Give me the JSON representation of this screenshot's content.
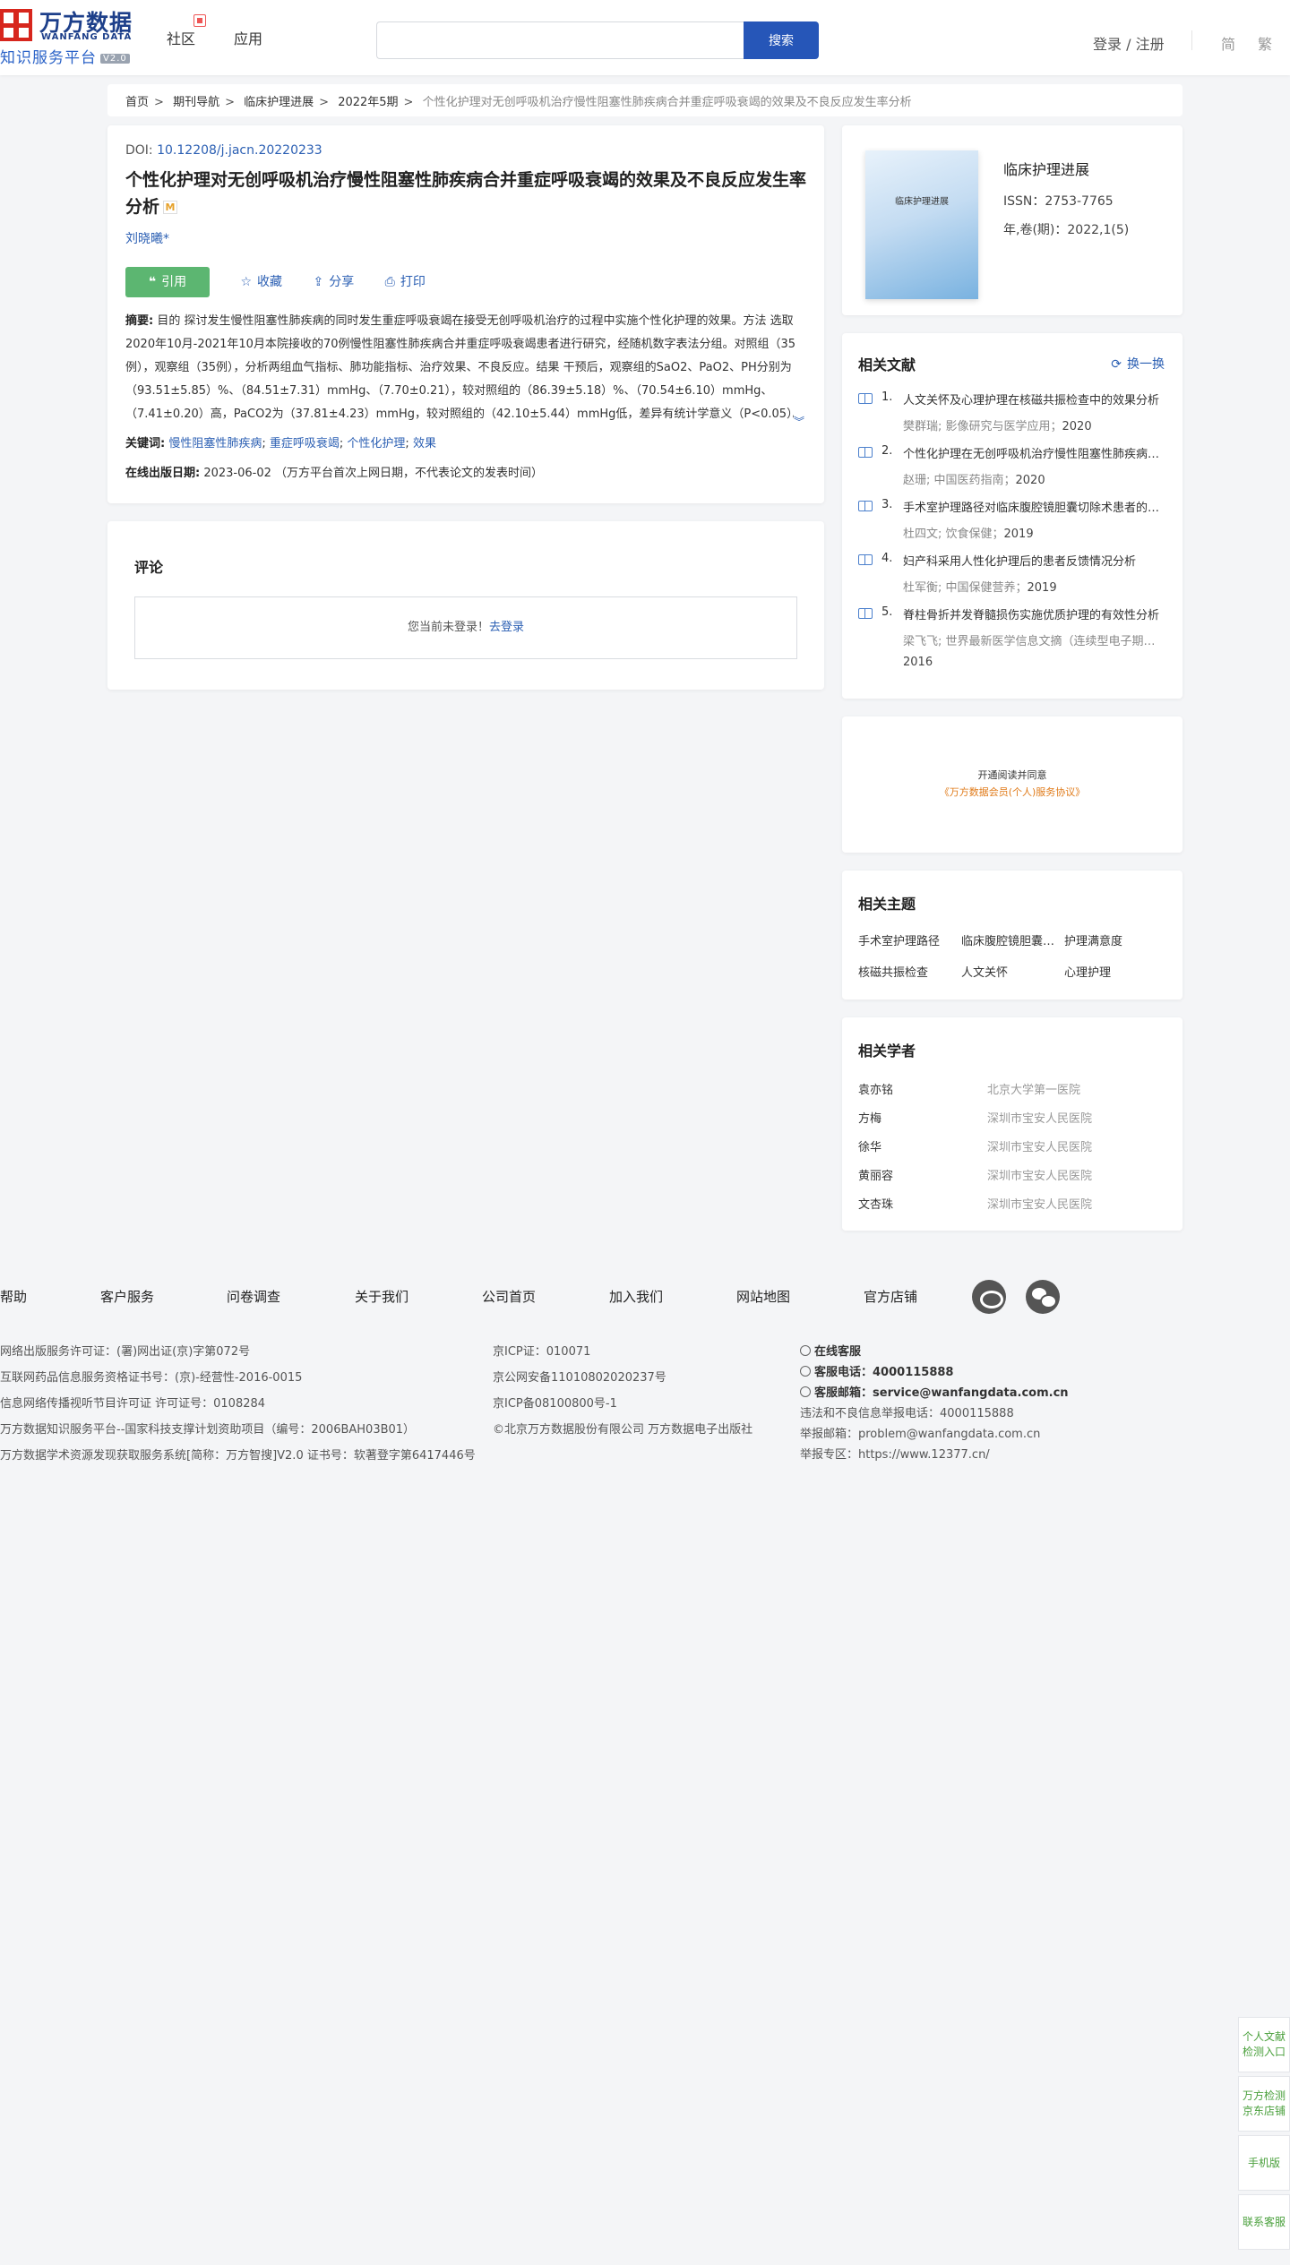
{
  "header": {
    "logo_cn": "万方数据",
    "logo_en": "WANFANG DATA",
    "platform_name": "知识服务平台",
    "version": "V2.0",
    "nav": [
      "社区",
      "应用"
    ],
    "search_placeholder": "",
    "search_button": "搜索",
    "login": "登录 / 注册",
    "lang_simplified": "简",
    "lang_traditional": "繁"
  },
  "breadcrumb": {
    "items": [
      "首页",
      "期刊导航",
      "临床护理进展",
      "2022年5期"
    ],
    "current": "个性化护理对无创呼吸机治疗慢性阻塞性肺疾病合并重症呼吸衰竭的效果及不良反应发生率分析"
  },
  "article": {
    "doi_label": "DOI:",
    "doi": "10.12208/j.jacn.20220233",
    "title": "个性化护理对无创呼吸机治疗慢性阻塞性肺疾病合并重症呼吸衰竭的效果及不良反应发生率分析",
    "title_badge": "M",
    "author": "刘晓曦*",
    "actions": {
      "cite": "引用",
      "collect": "收藏",
      "share": "分享",
      "print": "打印"
    },
    "abstract_label": "摘要:",
    "abstract": "目的 探讨发生慢性阻塞性肺疾病的同时发生重症呼吸衰竭在接受无创呼吸机治疗的过程中实施个性化护理的效果。方法 选取2020年10月-2021年10月本院接收的70例慢性阻塞性肺疾病合并重症呼吸衰竭患者进行研究，经随机数字表法分组。对照组（35例），观察组（35例），分析两组血气指标、肺功能指标、治疗效果、不良反应。结果 干预后，观察组的SaO2、PaO2、PH分别为（93.51±5.85）%、（84.51±7.31）mmHg、（7.70±0.21），较对照组的（86.39±5.18）%、（70.54±6.10）mmHg、（7.41±0.20）高，PaCO2为（37.81±4.23）mmHg，较对照组的（42.10±5.44）mmHg低，差异有统计学意义（P<0.05）。",
    "keywords_label": "关键词:",
    "keywords": [
      "慢性阻塞性肺疾病",
      "重症呼吸衰竭",
      "个性化护理",
      "效果"
    ],
    "pubdate_label": "在线出版日期:",
    "pubdate": "2023-06-02 （万方平台首次上网日期，不代表论文的发表时间）"
  },
  "comments": {
    "title": "评论",
    "not_logged_in": "您当前未登录！",
    "login_link": "去登录"
  },
  "journal": {
    "cover_title": "临床护理进展",
    "name": "临床护理进展",
    "issn": "ISSN：2753-7765",
    "volume": "年,卷(期)：2022,1(5)"
  },
  "related_docs": {
    "title": "相关文献",
    "refresh": "换一换",
    "items": [
      {
        "num": "1.",
        "title": "人文关怀及心理护理在核磁共振检查中的效果分析",
        "meta": "樊群瑞; 影像研究与医学应用；",
        "year": "2020"
      },
      {
        "num": "2.",
        "title": "个性化护理在无创呼吸机治疗慢性阻塞性肺疾病中的应用",
        "meta": "赵珊; 中国医药指南；",
        "year": "2020"
      },
      {
        "num": "3.",
        "title": "手术室护理路径对临床腹腔镜胆囊切除术患者的影响",
        "meta": "杜四文; 饮食保健；",
        "year": "2019"
      },
      {
        "num": "4.",
        "title": "妇产科采用人性化护理后的患者反馈情况分析",
        "meta": "杜军衡; 中国保健营养；",
        "year": "2019"
      },
      {
        "num": "5.",
        "title": "脊柱骨折并发脊髓损伤实施优质护理的有效性分析",
        "meta": "梁飞飞; 世界最新医学信息文摘（连续型电子期刊）；",
        "year": "2016"
      }
    ]
  },
  "agreement": {
    "line1": "开通阅读并同意",
    "link": "《万方数据会员(个人)服务协议》"
  },
  "topics": {
    "title": "相关主题",
    "items": [
      "手术室护理路径",
      "临床腹腔镜胆囊切除术",
      "护理满意度",
      "核磁共振检查",
      "人文关怀",
      "心理护理"
    ]
  },
  "scholars": {
    "title": "相关学者",
    "items": [
      {
        "name": "袁亦铭",
        "inst": "北京大学第一医院"
      },
      {
        "name": "方梅",
        "inst": "深圳市宝安人民医院"
      },
      {
        "name": "徐华",
        "inst": "深圳市宝安人民医院"
      },
      {
        "name": "黄丽容",
        "inst": "深圳市宝安人民医院"
      },
      {
        "name": "文杏珠",
        "inst": "深圳市宝安人民医院"
      }
    ]
  },
  "footer": {
    "links": [
      "帮助",
      "客户服务",
      "问卷调查",
      "关于我们",
      "公司首页",
      "加入我们",
      "网站地图",
      "官方店铺"
    ],
    "col1": [
      "网络出版服务许可证：(署)网出证(京)字第072号",
      "互联网药品信息服务资格证书号：(京)-经营性-2016-0015",
      "信息网络传播视听节目许可证 许可证号：0108284",
      "万方数据知识服务平台--国家科技支撑计划资助项目（编号：2006BAH03B01）",
      "万方数据学术资源发现获取服务系统[简称：万方智搜]V2.0 证书号：软著登字第6417446号"
    ],
    "col2": [
      "京ICP证：010071",
      "京公网安备11010802020237号",
      "京ICP备08100800号-1",
      "©北京万方数据股份有限公司 万方数据电子出版社"
    ],
    "online_service": "在线客服",
    "phone_label": "客服电话：",
    "phone": "4000115888",
    "email_label": "客服邮箱：",
    "email": "service@wanfangdata.com.cn",
    "report_phone": "违法和不良信息举报电话：4000115888",
    "report_email": "举报邮箱：problem@wanfangdata.com.cn",
    "report_zone": "举报专区：https://www.12377.cn/"
  },
  "side_float": [
    "个人文献检测入口",
    "万方检测京东店铺",
    "手机版",
    "联系客服"
  ]
}
